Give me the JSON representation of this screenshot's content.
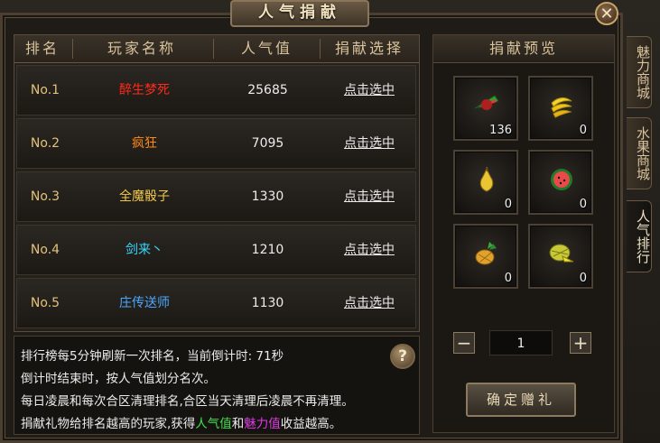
{
  "window": {
    "title": "人气捐献",
    "close_label": "✕"
  },
  "table": {
    "headers": [
      "排名",
      "玩家名称",
      "人气值",
      "捐献选择"
    ],
    "rows": [
      {
        "rank": "No.1",
        "name": "醉生梦死",
        "name_color": "#ff2a1a",
        "popularity": "25685",
        "action": "点击选中"
      },
      {
        "rank": "No.2",
        "name": "疯狂",
        "name_color": "#ff8a1a",
        "popularity": "7095",
        "action": "点击选中"
      },
      {
        "rank": "No.3",
        "name": "全魔骰子",
        "name_color": "#f0c84a",
        "popularity": "1330",
        "action": "点击选中"
      },
      {
        "rank": "No.4",
        "name": "剑来丶",
        "name_color": "#38d8ff",
        "popularity": "1210",
        "action": "点击选中"
      },
      {
        "rank": "No.5",
        "name": "庄传送师",
        "name_color": "#4aa8ff",
        "popularity": "1130",
        "action": "点击选中"
      }
    ]
  },
  "info": {
    "line1": "排行榜每5分钟刷新一次排名，当前倒计时: 71秒",
    "line2": "倒计时结束时，按人气值划分名次。",
    "line3": "每日凌晨和每次合区清理排名,合区当天清理后凌晨不再清理。",
    "line4_a": "捐献礼物给排名越高的玩家,获得",
    "line4_b": "人气值",
    "line4_c": "和",
    "line4_d": "魅力值",
    "line4_e": "收益越高。",
    "help_label": "?"
  },
  "preview": {
    "title": "捐献预览",
    "items": [
      {
        "icon": "watermelon-slice-icon",
        "count": "136"
      },
      {
        "icon": "banana-icon",
        "count": "0"
      },
      {
        "icon": "pear-icon",
        "count": "0"
      },
      {
        "icon": "watermelon-icon",
        "count": "0"
      },
      {
        "icon": "pineapple-icon",
        "count": "0"
      },
      {
        "icon": "durian-icon",
        "count": "0"
      }
    ],
    "minus_label": "−",
    "plus_label": "+",
    "quantity": "1",
    "confirm_label": "确定赠礼"
  },
  "side_tabs": [
    "魅力商城",
    "水果商城",
    "人气排行"
  ]
}
